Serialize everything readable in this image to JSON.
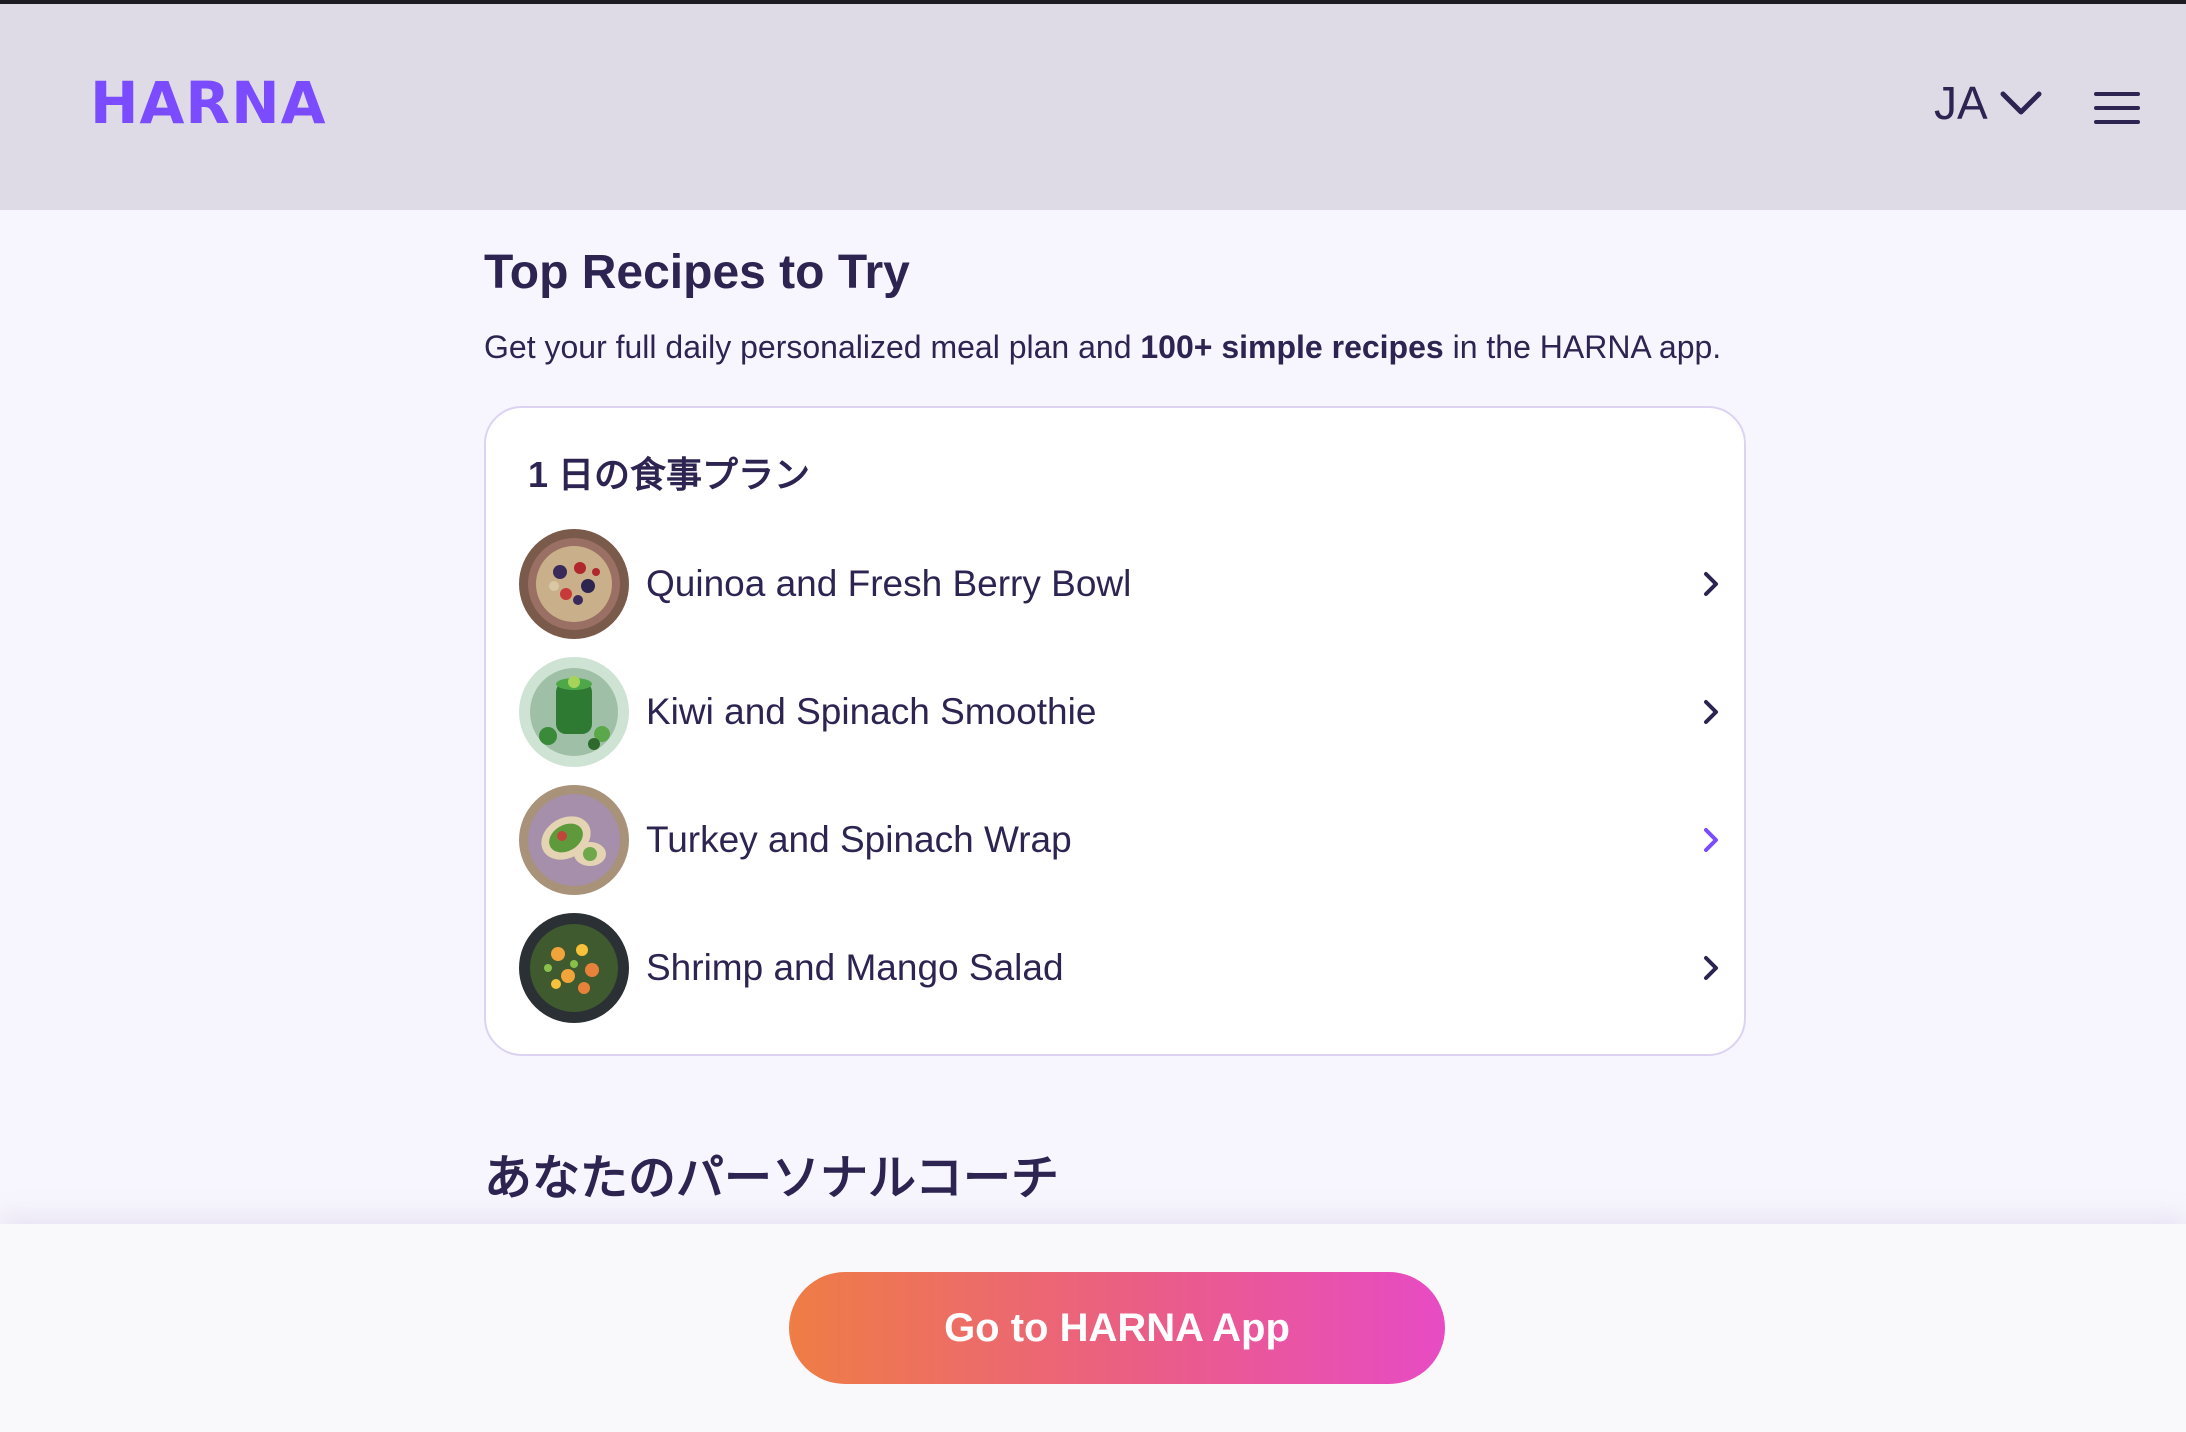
{
  "header": {
    "logo_text": "HARNA",
    "language_label": "JA"
  },
  "main": {
    "section_title": "Top Recipes to Try",
    "intro_text_before": "Get your full daily personalized meal plan and ",
    "intro_text_bold": "100+ simple recipes",
    "intro_text_after": " in the HARNA app."
  },
  "meal_plan": {
    "title": "1 日の食事プラン",
    "recipes": [
      {
        "name": "Quinoa and Fresh Berry Bowl",
        "icon": "quinoa-berry-bowl-photo"
      },
      {
        "name": "Kiwi and Spinach Smoothie",
        "icon": "kiwi-spinach-smoothie-photo"
      },
      {
        "name": "Turkey and Spinach Wrap",
        "icon": "turkey-spinach-wrap-photo"
      },
      {
        "name": "Shrimp and Mango Salad",
        "icon": "shrimp-mango-salad-photo"
      }
    ]
  },
  "coach": {
    "title": "あなたのパーソナルコーチ"
  },
  "cta": {
    "label": "Go to HARNA App"
  },
  "colors": {
    "brand": "#7b4bff",
    "text": "#2d2452",
    "header_bg": "#dedbe6",
    "page_bg": "#f7f5fd",
    "cta_gradient_start": "#ef7d45",
    "cta_gradient_end": "#e84bc4",
    "active_chevron": "#7b4bff"
  }
}
